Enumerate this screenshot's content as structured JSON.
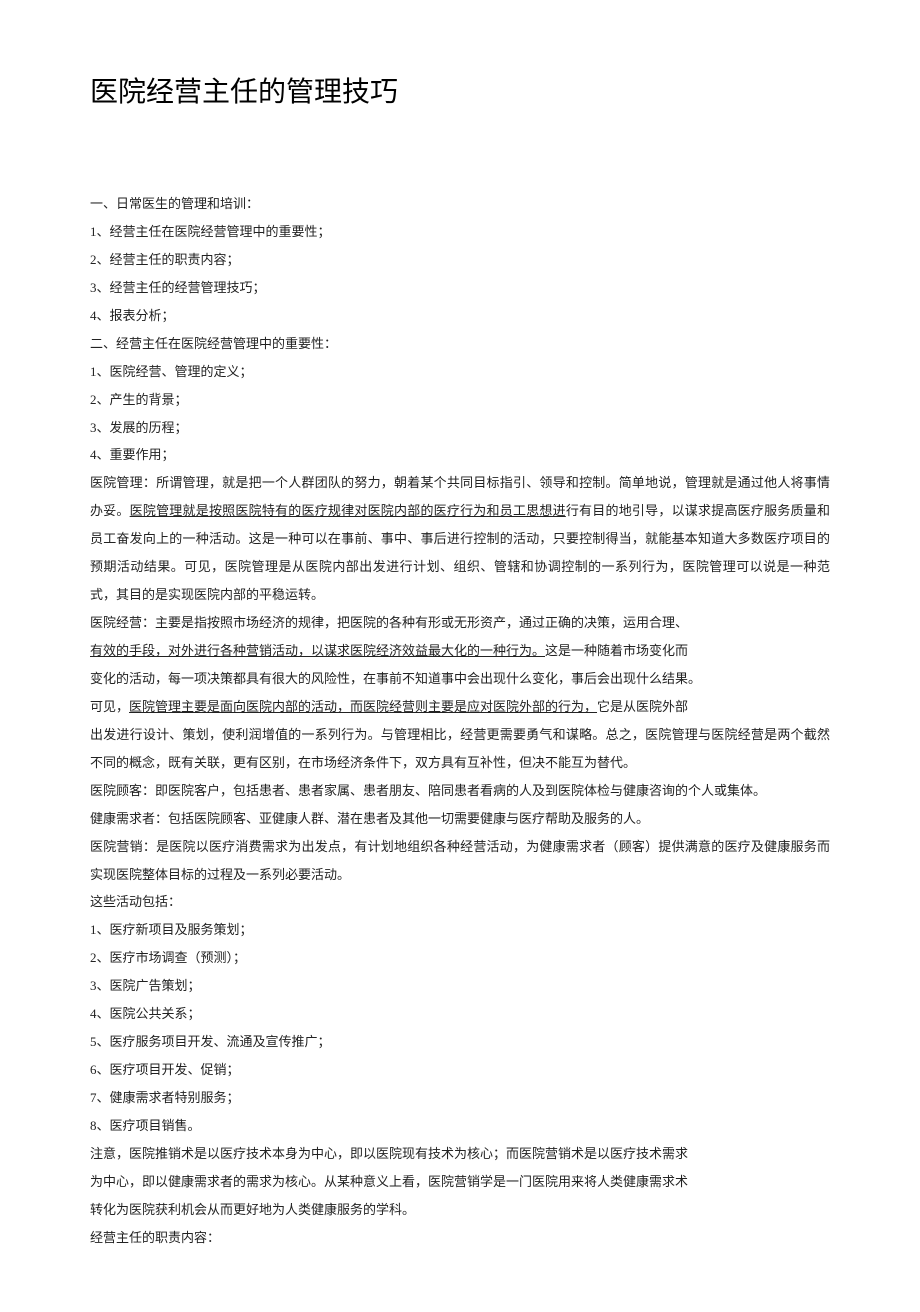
{
  "title": "医院经营主任的管理技巧",
  "section1_header": "一、日常医生的管理和培训：",
  "section1_items": [
    "1、经营主任在医院经营管理中的重要性；",
    "2、经营主任的职责内容；",
    "3、经营主任的经营管理技巧；",
    "4、报表分析；"
  ],
  "section2_header": "二、经营主任在医院经营管理中的重要性：",
  "section2_items": [
    "1、医院经营、管理的定义；",
    "2、产生的背景；",
    "3、发展的历程；",
    "4、重要作用；"
  ],
  "mgmt_pre": "医院管理：所谓管理，就是把一个人群团队的努力，朝着某个共同目标指引、领导和控制。简单地说，管理就是通过他人将事情办妥。",
  "mgmt_u1": "医院管理就是按照医院特有的医疗规律对医院内部的医疗行为和员工思想进",
  "mgmt_post1": "行有目的地引导，以谋求提高医疗服务质量和员工奋发向上的一种活动。这是一种可以在事前、事中、事后进行控制的活动，只要控制得当，就能基本知道大多数医疗项目的预期活动结果。可见，医院管理是从医院内部出发进行计划、组织、管辖和协调控制的一系列行为，医院管理可以说是一种范式，其目的是实现医院内部的平稳运转。",
  "biz_line1_pre": "医院经营：主要是指按照市场经济的规律，把医院的各种有形或无形资产，通过正确的决策，运用合理、",
  "biz_u2": "有效的手段，对外进行各种营销活动，以谋求医院经济效益最大化的一种行为。",
  "biz_line2_post": "这是一种随着市场变化而",
  "biz_line3": "变化的活动，每一项决策都具有很大的风险性，在事前不知道事中会出现什么变化，事后会出现什么结果。",
  "biz_line4_pre": "可见，",
  "biz_u3": "医院管理主要是面向医院内部的活动，而医院经营则主要是应对医院外部的行为，",
  "biz_line4_post": "它是从医院外部",
  "biz_line5": "出发进行设计、策划，使利润增值的一系列行为。与管理相比，经营更需要勇气和谋略。总之，医院管理与医院经营是两个截然不同的概念，既有关联，更有区别，在市场经济条件下，双方具有互补性，但决不能互为替代。",
  "customer": "医院顾客：即医院客户，包括患者、患者家属、患者朋友、陪同患者看病的人及到医院体检与健康咨询的个人或集体。",
  "health_seeker": "健康需求者：包括医院顾客、亚健康人群、潜在患者及其他一切需要健康与医疗帮助及服务的人。",
  "marketing": "医院营销：是医院以医疗消费需求为出发点，有计划地组织各种经营活动，为健康需求者（顾客）提供满意的医疗及健康服务而实现医院整体目标的过程及一系列必要活动。",
  "activities_header": "这些活动包括：",
  "activities": [
    "1、医疗新项目及服务策划；",
    "2、医疗市场调查（预测）；",
    "3、医院广告策划；",
    "4、医院公共关系；",
    "5、医疗服务项目开发、流通及宣传推广；",
    "6、医疗项目开发、促销；",
    "7、健康需求者特别服务；",
    "8、医疗项目销售。"
  ],
  "note1": "注意，医院推销术是以医疗技术本身为中心，即以医院现有技术为核心；而医院营销术是以医疗技术需求",
  "note2": "为中心，即以健康需求者的需求为核心。从某种意义上看，医院营销学是一门医院用来将人类健康需求术",
  "note3": "转化为医院获利机会从而更好地为人类健康服务的学科。",
  "duty_header": "经营主任的职责内容："
}
